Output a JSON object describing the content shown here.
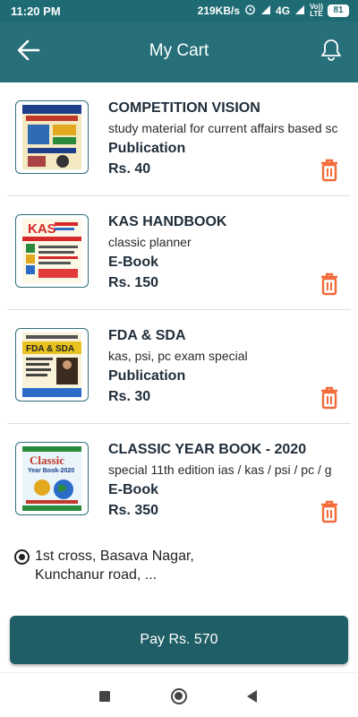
{
  "status_bar": {
    "time": "11:20 PM",
    "speed": "219KB/s",
    "network": "4G",
    "volte_top": "Vo))",
    "volte_bottom": "LTE",
    "battery": "81"
  },
  "app_bar": {
    "title": "My Cart",
    "back_icon": "arrow-left-icon",
    "bell_icon": "bell-icon"
  },
  "cart": {
    "items": [
      {
        "title": "COMPETITION VISION",
        "desc": "study material for current affairs based sc",
        "type": "Publication",
        "price": "Rs. 40"
      },
      {
        "title": "KAS HANDBOOK",
        "desc": "classic planner",
        "type": "E-Book",
        "price": "Rs. 150"
      },
      {
        "title": "FDA & SDA",
        "desc": "kas, psi, pc exam special",
        "type": "Publication",
        "price": "Rs. 30"
      },
      {
        "title": "CLASSIC YEAR BOOK - 2020",
        "desc": "special 11th edition ias / kas / psi / pc / g",
        "type": "E-Book",
        "price": "Rs. 350"
      }
    ],
    "thumb_labels": {
      "kas": "KAS",
      "fda": "FDA & SDA",
      "classic_title": "Classic",
      "classic_sub": "Year Book-2020"
    }
  },
  "address": {
    "line1": "1st cross, Basava Nagar,",
    "line2": "Kunchanur road, ..."
  },
  "pay_button": {
    "label": "Pay Rs. 570"
  },
  "colors": {
    "status_bar": "#1e6b74",
    "app_bar": "#276f79",
    "pay_button": "#1f5e66",
    "delete": "#f26a3a"
  }
}
